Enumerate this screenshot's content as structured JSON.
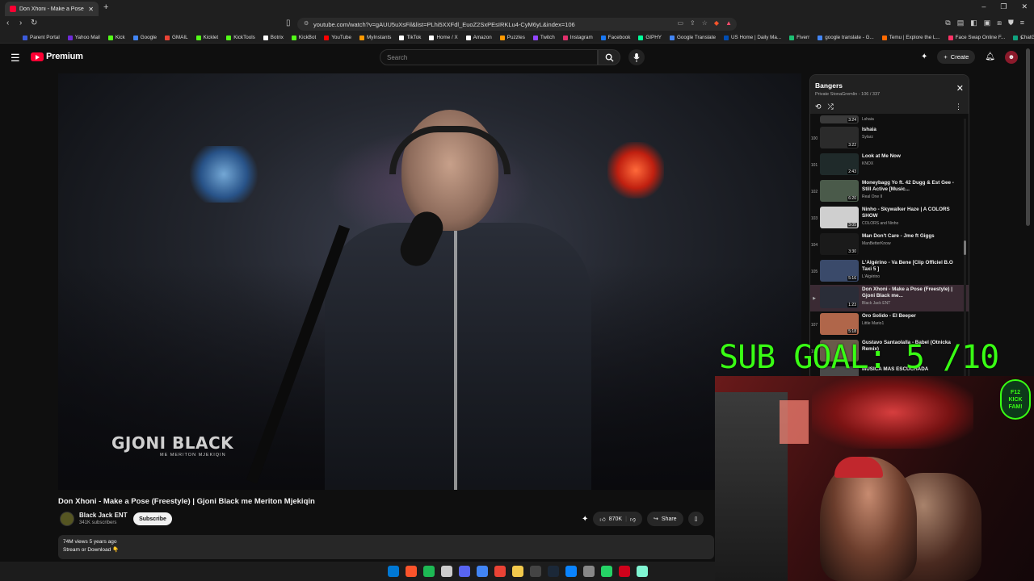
{
  "browser": {
    "tab_title": "Don Xhoni - Make a Pose (Fr...",
    "url": "youtube.com/watch?v=gAUU5uXsFil&list=PLhi5XXFdl_EuoZ2SxPEsIRKLu4-CyM6yL&index=106",
    "bookmarks": [
      "Parent Portal",
      "Yahoo Mail",
      "Kick",
      "Google",
      "GMAIL",
      "Kicklet",
      "KickTools",
      "Botrix",
      "KickBot",
      "YouTube",
      "MyInstants",
      "TikTok",
      "Home / X",
      "Amazon",
      "Puzzles",
      "Twitch",
      "Instagram",
      "Facebook",
      "GIPHY",
      "Google Translate",
      "US Home | Daily Ma...",
      "Fiverr",
      "google translate - G...",
      "Temu | Explore the L...",
      "Face Swap Online F...",
      "ChatGPT"
    ],
    "bookmark_colors": [
      "#3b5bdb",
      "#6f2bd9",
      "#53fc18",
      "#4285f4",
      "#ea4335",
      "#53fc18",
      "#53fc18",
      "#ffffff",
      "#53fc18",
      "#ff0000",
      "#ff9900",
      "#ffffff",
      "#ffffff",
      "#ffffff",
      "#ff9900",
      "#9146ff",
      "#e1306c",
      "#1877f2",
      "#00ff99",
      "#4285f4",
      "#004db3",
      "#1dbf73",
      "#4285f4",
      "#ff6a00",
      "#ff3366",
      "#10a37f"
    ]
  },
  "youtube": {
    "logo_text": "Premium",
    "search_placeholder": "Search",
    "create_label": "Create"
  },
  "video": {
    "watermark": "GJONI BLACK",
    "watermark_sub": "ME MERITON MJEKIQIN",
    "title": "Don Xhoni - Make a Pose (Freestyle) | Gjoni Black me Meriton Mjekiqin",
    "channel": "Black Jack ENT",
    "subscribers": "341K subscribers",
    "subscribe_label": "Subscribe",
    "likes": "870K",
    "share_label": "Share",
    "views_line": "74M views  5 years ago",
    "desc_line": "Stream or Download 👇"
  },
  "playlist": {
    "title": "Bangers",
    "subtitle": "Private StonaGremlin - 106 / 337",
    "items": [
      {
        "index": "",
        "name": "",
        "artist": "Lshaia",
        "duration": "3:24",
        "color": "#3a3a3a"
      },
      {
        "index": "100",
        "name": "Ishaia",
        "artist": "Sylarz",
        "duration": "3:22",
        "color": "#2b2b2b"
      },
      {
        "index": "101",
        "name": "Look at Me Now",
        "artist": "KNOX",
        "duration": "2:43",
        "color": "#1f2a2a"
      },
      {
        "index": "102",
        "name": "Moneybagg Yo ft. 42 Dugg & Est Gee - Still Active [Music...",
        "artist": "Real One II",
        "duration": "6:20",
        "color": "#4a5a4a"
      },
      {
        "index": "103",
        "name": "Ninho - Skywalker Haze | A COLORS SHOW",
        "artist": "COLORS and Ninho",
        "duration": "3:05",
        "color": "#cfcfcf"
      },
      {
        "index": "104",
        "name": "Man Don't Care - Jme ft Giggs",
        "artist": "ManBetterKnow",
        "duration": "3:30",
        "color": "#1a1a1a"
      },
      {
        "index": "105",
        "name": "L'Algérino - Va Bene [Clip Officiel B.O Taxi 5 ]",
        "artist": "L'Algérino",
        "duration": "5:16",
        "color": "#3a4a6a"
      },
      {
        "index": "▶",
        "name": "Don Xhoni - Make a Pose (Freestyle) | Gjoni Black me...",
        "artist": "Black Jack ENT",
        "duration": "1:23",
        "color": "#2a2d38"
      },
      {
        "index": "107",
        "name": "Oro Solido - El Beeper",
        "artist": "Little Mario1",
        "duration": "5:18",
        "color": "#b0664a"
      },
      {
        "index": "108",
        "name": "Gustavo Santaolalla - Babel (Otnicka Remix)",
        "artist": "",
        "duration": "",
        "color": "#6a5a4a"
      },
      {
        "index": "109",
        "name": "MUSICA MAS ESCUCHADA",
        "artist": "",
        "duration": "",
        "color": "#4a4a4a"
      }
    ]
  },
  "overlay": {
    "sub_goal": "SUB GOAL: 5 /10",
    "badge_line1": "F12",
    "badge_line2": "KICK",
    "badge_line3": "FAM!"
  },
  "taskbar": {
    "icons": [
      "windows-icon",
      "brave-icon",
      "spotify-icon",
      "calendar-icon",
      "discord-icon",
      "chrome-icon",
      "maps-icon",
      "files-icon",
      "obs-icon",
      "steam-icon",
      "photos-icon",
      "settings-icon",
      "whatsapp-icon",
      "location-icon",
      "streamlabs-icon"
    ],
    "colors": [
      "#0078d4",
      "#fb542b",
      "#1db954",
      "#cccccc",
      "#5865f2",
      "#4285f4",
      "#ea4335",
      "#f2c94c",
      "#444444",
      "#1b2838",
      "#0a84ff",
      "#888888",
      "#25d366",
      "#d0021b",
      "#80f5d2"
    ]
  }
}
